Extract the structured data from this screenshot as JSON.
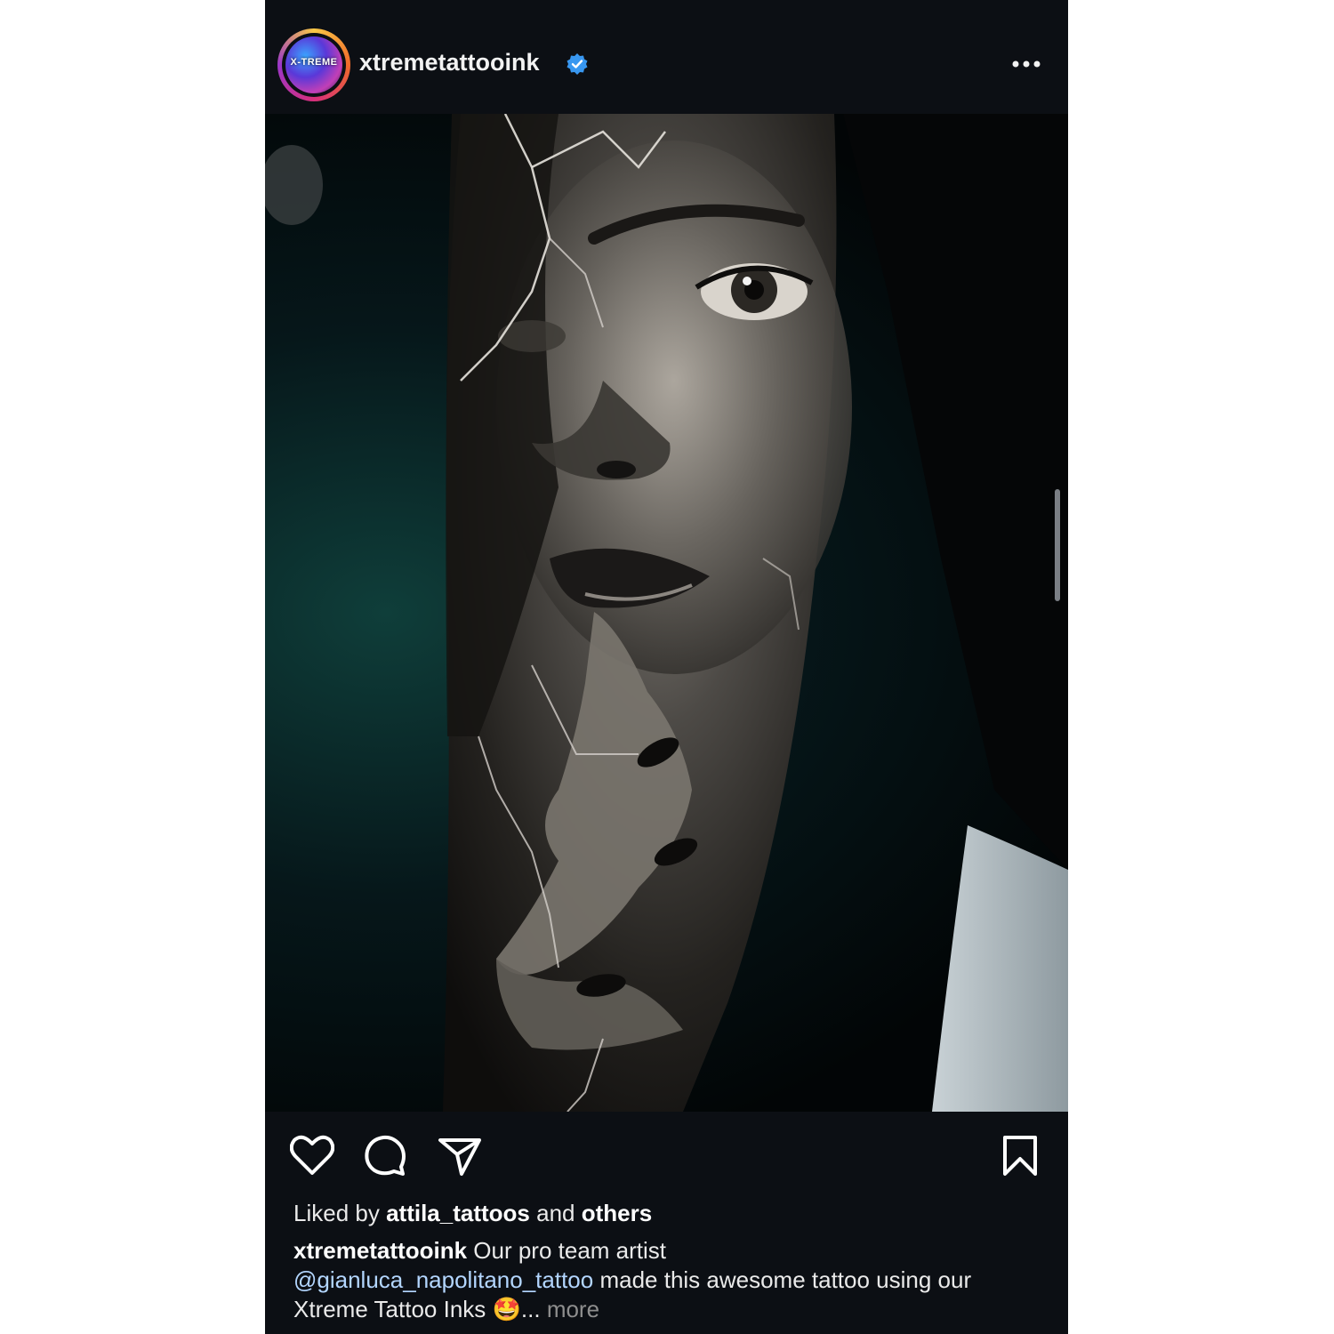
{
  "post": {
    "username": "xtremetattooink",
    "avatar_text": "X-TREME",
    "verified_icon": "verified-badge-icon",
    "more_icon": "more-options-icon",
    "image_description_icon": "tattoo-photo"
  },
  "actions": {
    "like_icon": "heart-icon",
    "comment_icon": "comment-icon",
    "share_icon": "send-icon",
    "save_icon": "bookmark-icon"
  },
  "likes": {
    "prefix": "Liked by",
    "user": "attila_tattoos",
    "conj": "and",
    "others": "others"
  },
  "caption": {
    "user": "xtremetattooink",
    "text1": "Our pro team artist",
    "mention": "@gianluca_napolitano_tattoo",
    "text2": "made this awesome tattoo using our Xtreme Tattoo Inks",
    "emoji": "🤩",
    "ellipsis": "...",
    "more": "more"
  },
  "colors": {
    "background": "#0c0f14",
    "verified": "#3897f0",
    "mention": "#b3d6ff"
  }
}
